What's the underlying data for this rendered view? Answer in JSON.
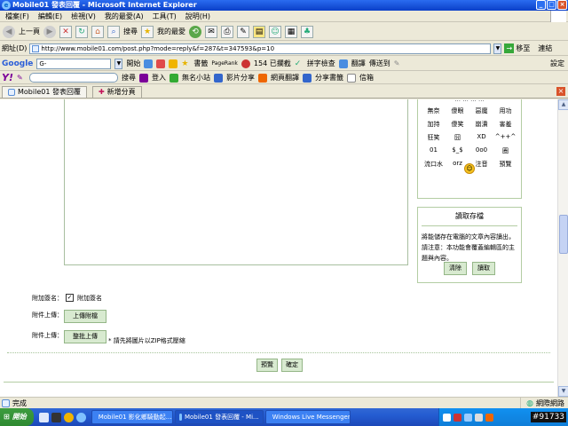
{
  "window": {
    "title": "Mobile01 發表回覆 - Microsoft Internet Explorer",
    "min": "_",
    "max": "□",
    "close": "×"
  },
  "menubar": [
    "檔案(F)",
    "編輯(E)",
    "檢視(V)",
    "我的最愛(A)",
    "工具(T)",
    "說明(H)"
  ],
  "toolbar": {
    "back_label": "上一頁",
    "search_label": "搜尋",
    "favorites_label": "我的最愛"
  },
  "address": {
    "label": "網址(D)",
    "url": "http://www.mobile01.com/post.php?mode=reply&f=287&t=347593&p=10",
    "go_label": "移至",
    "links_label": "連結"
  },
  "googlebar": {
    "logo": "Google",
    "input_value": "G-",
    "start_label": "開始",
    "bookmarks_label": "書籤",
    "pagerank_label": "PageRank",
    "blocked_label": "154 已攔截",
    "spellcheck_label": "拼字檢查",
    "translate_label": "翻譯",
    "sendto_label": "傳送到",
    "settings_label": "設定"
  },
  "yahoobar": {
    "logo": "Y!",
    "search_label": "搜尋",
    "signin_label": "登入",
    "widget_label": "無名小站",
    "video_label": "影片分享",
    "web_translate_label": "網頁翻譯",
    "share_bookmark_label": "分享書籤",
    "mail_label": "信箱"
  },
  "tabs": [
    {
      "label": "Mobile01 發表回覆"
    },
    {
      "label": "新增分頁"
    }
  ],
  "emoticons": {
    "cut_row": "... ... ... ...",
    "rows": [
      [
        "無奈",
        "傻眼",
        "惡魔",
        "用功"
      ],
      [
        "加持",
        "傻笑",
        "崩潰",
        "害羞"
      ],
      [
        "狂笑",
        "囧",
        "XD",
        "^++^"
      ],
      [
        "01",
        "$_$",
        "0o0",
        "圈"
      ],
      [
        "流口水",
        "orz",
        "注音",
        "預覽"
      ]
    ]
  },
  "draft": {
    "title": "讀取存檔",
    "text": "將能儲存在電腦的文章內容讀出，請注意：本功能會覆蓋編輯區的主題與內容。",
    "clear_label": "清除",
    "load_label": "讀取"
  },
  "form": {
    "signature_label": "附加簽名：",
    "signature_checkbox_label": "附加簽名",
    "signature_checked": true,
    "attach_label": "附件上傳：",
    "attach_button": "上傳附檔",
    "batch_label": "附件上傳：",
    "batch_button": "整批上傳",
    "batch_note": "* 請先將圖片以ZIP格式壓縮",
    "preview_button": "預覽",
    "submit_button": "確定"
  },
  "status": {
    "text": "完成",
    "zone": "網際網路"
  },
  "taskbar": {
    "start_label": "開始",
    "tasks": [
      "Mobile01 影化鄉騎動起...",
      "Mobile01 發表回覆 - Mi...",
      "Windows Live Messenger"
    ],
    "clock": "#91733"
  },
  "colors": {
    "title_blue": "#0a3fc8",
    "panel_border": "#b3cda3",
    "button_green": "#d8ead0",
    "taskbar_blue": "#245cd1"
  }
}
